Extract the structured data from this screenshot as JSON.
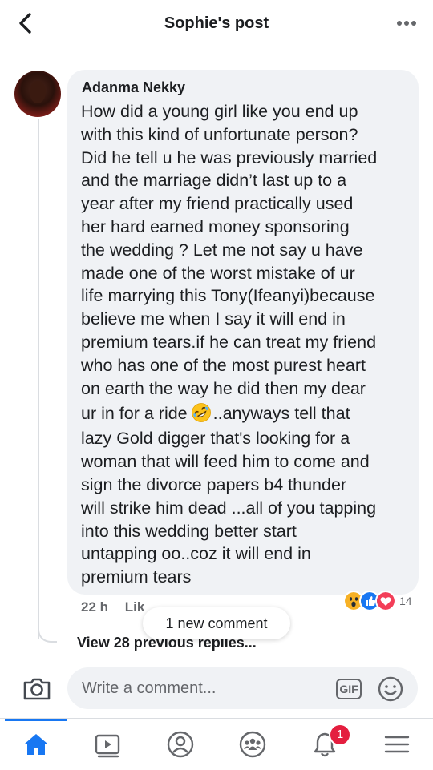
{
  "header": {
    "title": "Sophie's post"
  },
  "comment": {
    "author": "Adanma Nekky",
    "lines": [
      "How did a young girl like you end up",
      "with this kind of unfortunate person?",
      "Did he tell u he was previously married",
      "and the marriage didn’t last up to a",
      "year after my friend practically used",
      "her hard earned money sponsoring",
      "the wedding ? Let me not say u have",
      "made one of the worst mistake of ur",
      "life marrying this Tony(Ifeanyi)because",
      "believe me when I say it will end in",
      "premium tears.if he can treat my friend",
      "who has one of the most purest heart",
      "on earth the way he did then my dear"
    ],
    "emoji_line_before": "ur in for a ride",
    "emoji_line_after": "..anyways tell that",
    "lines_after": [
      "lazy Gold digger that's looking for a",
      "woman that will feed him to come and",
      "sign the divorce papers b4 thunder",
      "will strike him dead ...all of you tapping",
      "into this wedding better start",
      "untapping oo..coz it will end in",
      "premium tears"
    ],
    "inline_emoji": "rolling-on-floor-laughing-emoji"
  },
  "meta": {
    "time": "22 h",
    "like": "Lik"
  },
  "reactions": {
    "icons": [
      "wow-reaction-icon",
      "like-reaction-icon",
      "love-reaction-icon"
    ],
    "count": "14",
    "colors": {
      "wow": "#f7b125",
      "like": "#1877f2",
      "love": "#f33e58"
    }
  },
  "new_comment_pill": "1 new comment",
  "view_replies": "View 28 previous replies...",
  "composer": {
    "placeholder": "Write a comment...",
    "gif_label": "GIF"
  },
  "tabbar": {
    "items": [
      "home-icon",
      "watch-icon",
      "profile-icon",
      "groups-icon",
      "notifications-icon",
      "menu-icon"
    ],
    "active": "home-icon",
    "notification_badge": "1"
  },
  "colors": {
    "accent": "#1877f2",
    "bubble": "#f0f2f5",
    "secondary_text": "#65676b",
    "badge": "#e41e3f"
  }
}
